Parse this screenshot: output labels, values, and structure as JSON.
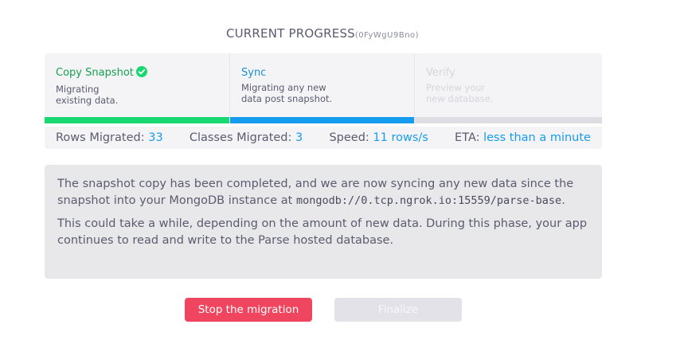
{
  "header": {
    "title": "CURRENT PROGRESS",
    "app_id": "(0FyWgU9Bno)"
  },
  "steps": [
    {
      "name": "Copy Snapshot",
      "desc_line1": "Migrating",
      "desc_line2": "existing data.",
      "state": "complete",
      "status_icon": "check-circle-icon"
    },
    {
      "name": "Sync",
      "desc_line1": "Migrating any new",
      "desc_line2": "data post snapshot.",
      "state": "active"
    },
    {
      "name": "Verify",
      "desc_line1": "Preview your",
      "desc_line2": "new database.",
      "state": "pending"
    }
  ],
  "stats": {
    "rows_label": "Rows Migrated:",
    "rows_value": "33",
    "classes_label": "Classes Migrated:",
    "classes_value": "3",
    "speed_label": "Speed:",
    "speed_value": "11 rows/s",
    "eta_label": "ETA:",
    "eta_value": "less than a minute"
  },
  "info": {
    "p1_before": "The snapshot copy has been completed, and we are now syncing any new data since the snapshot into your MongoDB instance at ",
    "p1_code": "mongodb://0.tcp.ngrok.io:15559/parse-base",
    "p1_after": ".",
    "p2": "This could take a while, depending on the amount of new data. During this phase, your app continues to read and write to the Parse hosted database."
  },
  "buttons": {
    "stop_label": "Stop the migration",
    "finalize_label": "Finalize"
  },
  "colors": {
    "complete": "#18d872",
    "active": "#169cee",
    "pending": "#dddde2",
    "danger": "#f0455f"
  }
}
